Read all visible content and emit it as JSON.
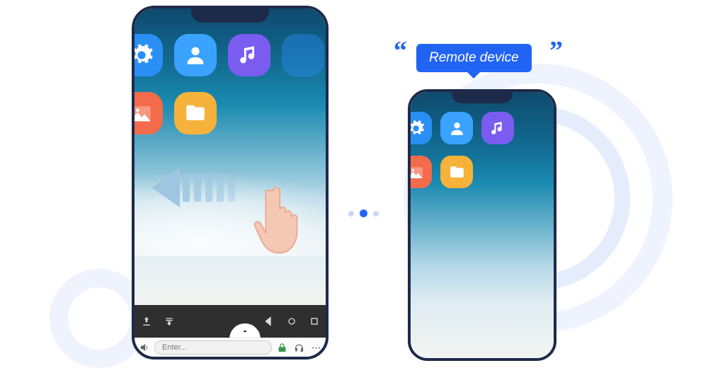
{
  "label": {
    "text": "Remote device"
  },
  "local": {
    "input_placeholder": "Enter...",
    "apps_row1": [
      "settings",
      "contacts",
      "music"
    ],
    "apps_row2": [
      "gallery",
      "files"
    ],
    "toolbar_left_icons": [
      "upload",
      "download-list"
    ],
    "nav_icons": [
      "back",
      "home",
      "recent"
    ],
    "input_bar_icons": {
      "left": "sound",
      "right": [
        "link-lock",
        "headset",
        "more"
      ]
    }
  },
  "remote": {
    "apps_row1": [
      "settings",
      "contacts",
      "music"
    ],
    "apps_row2": [
      "gallery",
      "files"
    ]
  },
  "icon_colors": {
    "settings": "#2a8ff5",
    "contacts": "#3aa2ff",
    "music": "#7b5cf0",
    "gallery": "#f36b4b",
    "files": "#f6b23a"
  },
  "gesture": {
    "direction": "left",
    "type": "swipe"
  }
}
